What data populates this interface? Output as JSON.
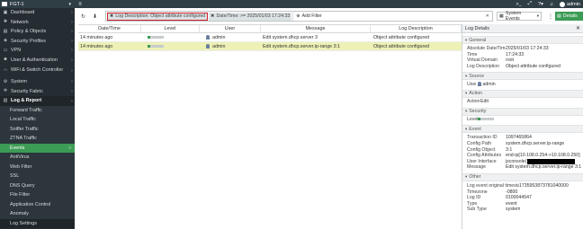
{
  "topbar": {
    "device_name": "FGT-1",
    "admin_label": "admin"
  },
  "sidebar": {
    "items": [
      {
        "label": "Dashboard",
        "icon": "dashboard-icon",
        "chev": ">"
      },
      {
        "label": "Network",
        "icon": "network-icon",
        "chev": ">"
      },
      {
        "label": "Policy & Objects",
        "icon": "policy-icon",
        "chev": ">"
      },
      {
        "label": "Security Profiles",
        "icon": "security-profiles-icon",
        "chev": ">"
      },
      {
        "label": "VPN",
        "icon": "vpn-icon",
        "chev": ">"
      },
      {
        "label": "User & Authentication",
        "icon": "user-icon",
        "chev": ">"
      },
      {
        "label": "WiFi & Switch Controller",
        "icon": "wifi-icon",
        "chev": ">"
      },
      {
        "label": "System",
        "icon": "system-icon",
        "chev": ">"
      },
      {
        "label": "Security Fabric",
        "icon": "fabric-icon",
        "chev": ">"
      },
      {
        "label": "Log & Report",
        "icon": "log-icon",
        "chev": "v"
      }
    ],
    "sub_items": [
      "Forward Traffic",
      "Local Traffic",
      "Sniffer Traffic",
      "ZTNA Traffic",
      "Events",
      "AntiVirus",
      "Web Filter",
      "SSL",
      "DNS Query",
      "File Filter",
      "Application Control",
      "Anomaly",
      "Log Settings"
    ],
    "active_item": "Events"
  },
  "toolbar": {
    "filter_chip_1": "Log Description: Object attribute configured",
    "filter_chip_2": "Date/Time: >= 2025/01/03 17:24:33",
    "add_filter": "Add Filter",
    "system_events": "System Events",
    "details": "Details"
  },
  "table": {
    "headers": [
      "Date/Time",
      "Level",
      "User",
      "Message",
      "Log Description"
    ],
    "rows": [
      {
        "time": "14 minutes ago",
        "level": 1,
        "user": "admin",
        "message": "Edit system.dhcp.server 3",
        "desc": "Object attribute configured",
        "selected": false
      },
      {
        "time": "14 minutes ago",
        "level": 1,
        "user": "admin",
        "message": "Edit system.dhcp.server.ip-range 3:1",
        "desc": "Object attribute configured",
        "selected": true
      }
    ]
  },
  "details": {
    "title": "Log Details",
    "sections": {
      "general": "General",
      "source": "Source",
      "action": "Action",
      "security": "Security",
      "event": "Event",
      "other": "Other"
    },
    "general": [
      {
        "k": "Absolute Date/Time",
        "v": "2025/01/03 17:24:33"
      },
      {
        "k": "Time",
        "v": "17:24:33"
      },
      {
        "k": "Virtual Domain",
        "v": "root"
      },
      {
        "k": "Log Description",
        "v": "Object attribute configured"
      }
    ],
    "source": {
      "k": "User",
      "v": "admin"
    },
    "action": {
      "k": "Action",
      "v": "Edit"
    },
    "security": {
      "k": "Level"
    },
    "event": [
      {
        "k": "Transaction ID",
        "v": "1097465864"
      },
      {
        "k": "Config Path",
        "v": "system.dhcp.server.ip-range"
      },
      {
        "k": "Config Object",
        "v": "3:1"
      },
      {
        "k": "Config Attributes",
        "v": "end-ip[10.108.0.254->10.108.0.250]"
      },
      {
        "k": "User Interface",
        "v": "jsconsole("
      },
      {
        "k": "Message",
        "v": "Edit system.dhcp.server.ip-range 3:1"
      }
    ],
    "other": [
      {
        "k": "Log event original timestamp",
        "v": "1735953873781040000"
      },
      {
        "k": "Timezone",
        "v": "-0800"
      },
      {
        "k": "Log ID",
        "v": "0100044547"
      },
      {
        "k": "Type",
        "v": "event"
      },
      {
        "k": "Sub Type",
        "v": "system"
      }
    ]
  },
  "colors": {
    "accent": "#3c9b55",
    "sidebar": "#252d33",
    "topbar": "#2f3d45",
    "selected_row": "#edf1b6",
    "highlight_border": "#d0202a"
  }
}
